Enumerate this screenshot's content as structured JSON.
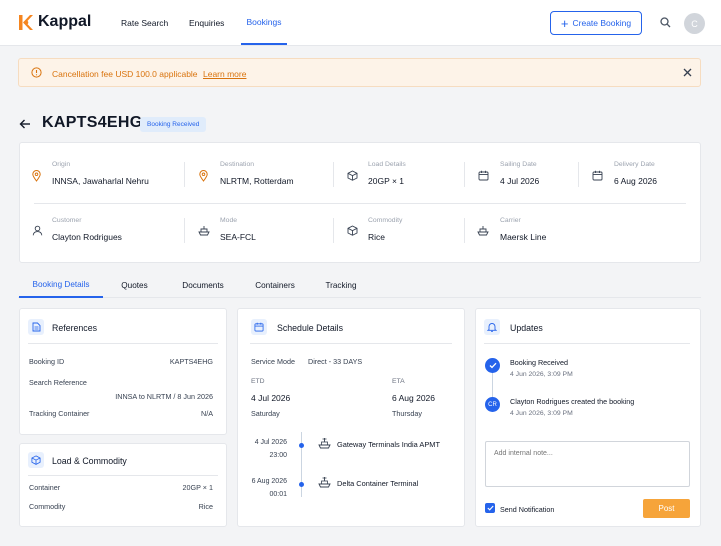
{
  "header": {
    "brand": "Kappal",
    "nav": [
      "Rate Search",
      "Enquiries",
      "Bookings"
    ],
    "active_nav": "Bookings",
    "create_button": "Create Booking",
    "avatar_initial": "C"
  },
  "alert": {
    "message": "Cancellation fee USD 100.0 applicable",
    "link": "Learn more"
  },
  "booking": {
    "id": "KAPTS4EHG",
    "status": "Booking Received"
  },
  "info": {
    "origin": {
      "label": "Origin",
      "value": "INNSA, Jawaharlal Nehru"
    },
    "destination": {
      "label": "Destination",
      "value": "NLRTM, Rotterdam"
    },
    "load": {
      "label": "Load Details",
      "value": "20GP × 1"
    },
    "sailing": {
      "label": "Sailing Date",
      "value": "4 Jul 2026"
    },
    "delivery": {
      "label": "Delivery Date",
      "value": "6 Aug 2026"
    },
    "customer": {
      "label": "Customer",
      "value": "Clayton Rodrigues"
    },
    "mode": {
      "label": "Mode",
      "value": "SEA-FCL"
    },
    "commodity": {
      "label": "Commodity",
      "value": "Rice"
    },
    "carrier": {
      "label": "Carrier",
      "value": "Maersk Line"
    }
  },
  "tabs": [
    "Booking Details",
    "Quotes",
    "Documents",
    "Containers",
    "Tracking"
  ],
  "references": {
    "title": "References",
    "booking_id_label": "Booking ID",
    "booking_id": "KAPTS4EHG",
    "search_ref_label": "Search Reference",
    "search_ref": "INNSA to NLRTM / 8 Jun 2026",
    "tracking_label": "Tracking Container",
    "tracking": "N/A"
  },
  "load_commodity": {
    "title": "Load & Commodity",
    "container_label": "Container",
    "container": "20GP × 1",
    "commodity_label": "Commodity",
    "commodity": "Rice"
  },
  "schedule": {
    "title": "Schedule Details",
    "service_mode_label": "Service Mode",
    "service_mode": "Direct - 33 DAYS",
    "etd_label": "ETD",
    "etd_date": "4 Jul 2026",
    "etd_day": "Saturday",
    "eta_label": "ETA",
    "eta_date": "6 Aug 2026",
    "eta_day": "Thursday",
    "stops": [
      {
        "date": "4 Jul 2026",
        "time": "23:00",
        "terminal": "Gateway Terminals India APMT"
      },
      {
        "date": "6 Aug 2026",
        "time": "00:01",
        "terminal": "Delta Container Terminal"
      }
    ]
  },
  "updates": {
    "title": "Updates",
    "items": [
      {
        "text": "Booking Received",
        "time": "4 Jun 2026, 3:09 PM"
      },
      {
        "badge": "CR",
        "text": "Clayton Rodrigues created the booking",
        "time": "4 Jun 2026, 3:09 PM"
      }
    ],
    "note_placeholder": "Add internal note...",
    "send_notification": "Send Notification",
    "post": "Post"
  },
  "colors": {
    "accent": "#2563eb",
    "brand_orange": "#f5851f",
    "post": "#f6a43a",
    "alert_text": "#d9730d"
  }
}
